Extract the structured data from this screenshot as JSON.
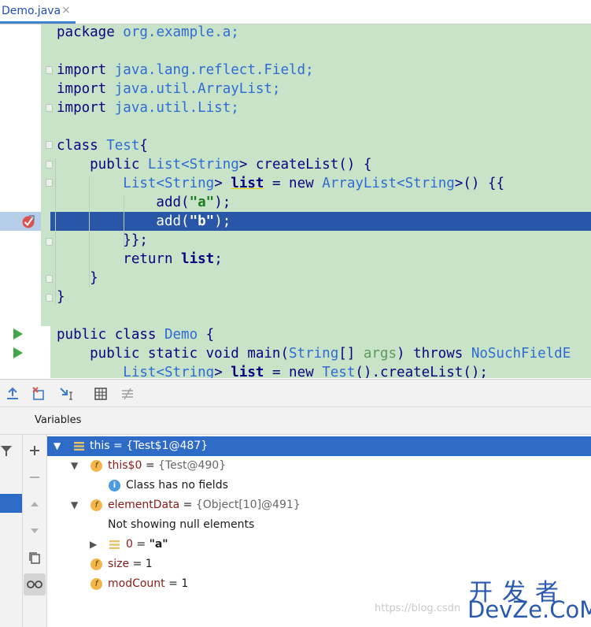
{
  "tab": {
    "label": "Demo.java",
    "close": "×"
  },
  "code": {
    "l1": [
      "package",
      " org.example.a;"
    ],
    "l2": [
      "import",
      " java.lang.reflect.Field;"
    ],
    "l3": [
      "import",
      " java.util.ArrayList;"
    ],
    "l4": [
      "import",
      " java.util.List;"
    ],
    "l5a": "class ",
    "l5b": "Test",
    "l5c": "{",
    "l6a": "    public ",
    "l6b": "List",
    "l6c": "<",
    "l6d": "String",
    "l6e": "> createList() {",
    "l7a": "        ",
    "l7b": "List",
    "l7c": "<",
    "l7d": "String",
    "l7e": "> ",
    "l7f": "list",
    "l7g": " = new ",
    "l7h": "ArrayList",
    "l7i": "<",
    "l7j": "String",
    "l7k": ">() {{",
    "l8a": "            add(",
    "l8b": "\"a\"",
    "l8c": ");",
    "l9a": "            add(",
    "l9b": "\"b\"",
    "l9c": ");",
    "l10": "        }};",
    "l11a": "        return ",
    "l11b": "list",
    "l11c": ";",
    "l12": "    }",
    "l13": "}",
    "l14a": "public class ",
    "l14b": "Demo",
    "l14c": " {",
    "l15a": "    public static void main(",
    "l15b": "String",
    "l15c": "[] ",
    "l15d": "args",
    "l15e": ") throws ",
    "l15f": "NoSuchFieldE",
    "l16a": "        ",
    "l16b": "List",
    "l16c": "<",
    "l16d": "String",
    "l16e": "> ",
    "l16f": "list",
    "l16g": " = new ",
    "l16h": "Test",
    "l16i": "().createList();"
  },
  "debugger": {
    "variables_title": "Variables",
    "rows": [
      {
        "name": "this",
        "eq": " = ",
        "value": "{Test$1@487}"
      },
      {
        "name": "this$0",
        "eq": " = ",
        "value": "{Test@490}"
      },
      {
        "text": "Class has no fields"
      },
      {
        "name": "elementData",
        "eq": " = ",
        "value": "{Object[10]@491}"
      },
      {
        "text": "Not showing null elements"
      },
      {
        "name": "0",
        "eq": " = ",
        "value": "\"a\""
      },
      {
        "name": "size",
        "eq": " = ",
        "value": "1"
      },
      {
        "name": "modCount",
        "eq": " = ",
        "value": "1"
      }
    ]
  },
  "watermark": "https://blog.csdn",
  "logo": {
    "top": "开发者",
    "bottom": "DevZe.CoM"
  },
  "colors": {
    "selection": "#2e6bc6",
    "code_bg": "#c9e3c9",
    "breakpoint_line": "#2a56a8"
  }
}
